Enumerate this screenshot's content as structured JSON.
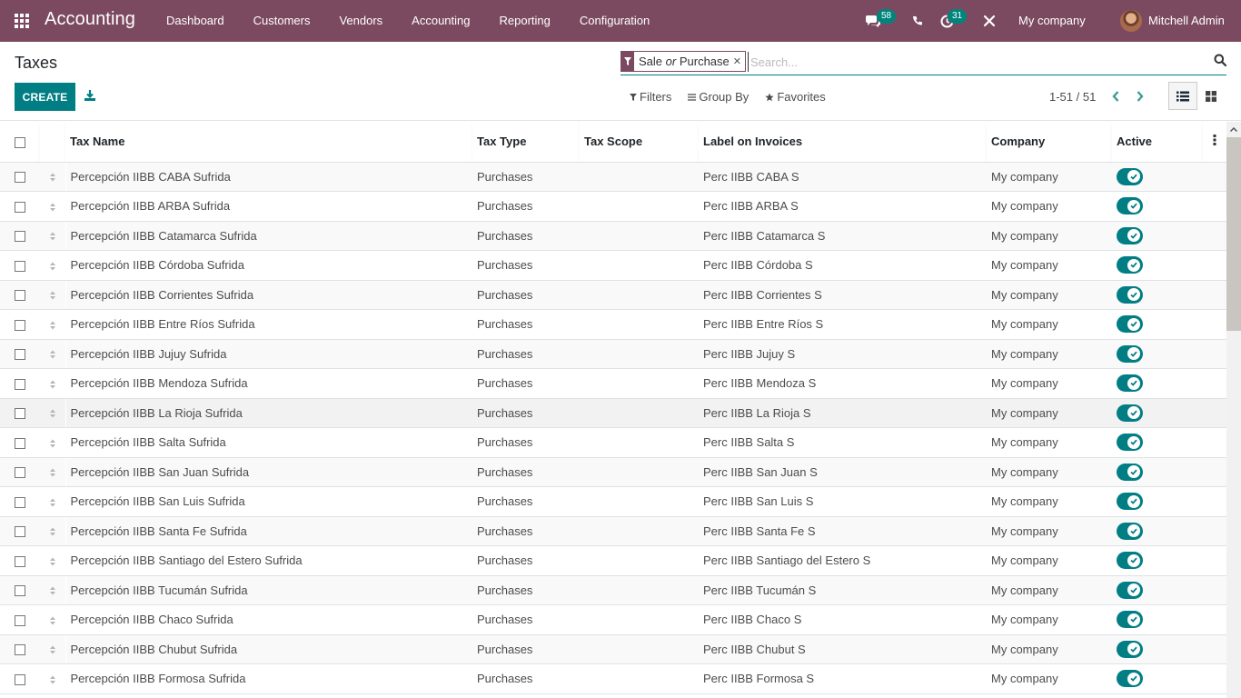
{
  "navbar": {
    "app_name": "Accounting",
    "menu": [
      "Dashboard",
      "Customers",
      "Vendors",
      "Accounting",
      "Reporting",
      "Configuration"
    ],
    "messages_count": "58",
    "activities_count": "31",
    "company": "My company",
    "user": "Mitchell Admin",
    "icons": [
      "apps-grid-icon",
      "chat-icon",
      "phone-icon",
      "activity-clock-icon",
      "debug-tools-icon"
    ]
  },
  "control_panel": {
    "title": "Taxes",
    "create_label": "CREATE",
    "facet": {
      "field": "Sale",
      "operator": "or",
      "value": "Purchase"
    },
    "search_placeholder": "Search...",
    "filters_label": "Filters",
    "groupby_label": "Group By",
    "favorites_label": "Favorites",
    "pager": "1-51 / 51"
  },
  "colors": {
    "brand": "#7c4a60",
    "primary": "#017e84",
    "badge": "#00857c"
  },
  "table": {
    "columns": [
      "Tax Name",
      "Tax Type",
      "Tax Scope",
      "Label on Invoices",
      "Company",
      "Active"
    ],
    "rows": [
      {
        "name": "Percepción IIBB CABA Sufrida",
        "type": "Purchases",
        "scope": "",
        "label": "Perc IIBB CABA S",
        "company": "My company",
        "active": true
      },
      {
        "name": "Percepción IIBB ARBA Sufrida",
        "type": "Purchases",
        "scope": "",
        "label": "Perc IIBB ARBA S",
        "company": "My company",
        "active": true
      },
      {
        "name": "Percepción IIBB Catamarca Sufrida",
        "type": "Purchases",
        "scope": "",
        "label": "Perc IIBB Catamarca S",
        "company": "My company",
        "active": true
      },
      {
        "name": "Percepción IIBB Córdoba Sufrida",
        "type": "Purchases",
        "scope": "",
        "label": "Perc IIBB Córdoba S",
        "company": "My company",
        "active": true
      },
      {
        "name": "Percepción IIBB Corrientes Sufrida",
        "type": "Purchases",
        "scope": "",
        "label": "Perc IIBB Corrientes S",
        "company": "My company",
        "active": true
      },
      {
        "name": "Percepción IIBB Entre Ríos Sufrida",
        "type": "Purchases",
        "scope": "",
        "label": "Perc IIBB Entre Ríos S",
        "company": "My company",
        "active": true
      },
      {
        "name": "Percepción IIBB Jujuy Sufrida",
        "type": "Purchases",
        "scope": "",
        "label": "Perc IIBB Jujuy S",
        "company": "My company",
        "active": true
      },
      {
        "name": "Percepción IIBB Mendoza Sufrida",
        "type": "Purchases",
        "scope": "",
        "label": "Perc IIBB Mendoza S",
        "company": "My company",
        "active": true
      },
      {
        "name": "Percepción IIBB La Rioja Sufrida",
        "type": "Purchases",
        "scope": "",
        "label": "Perc IIBB La Rioja S",
        "company": "My company",
        "active": true
      },
      {
        "name": "Percepción IIBB Salta Sufrida",
        "type": "Purchases",
        "scope": "",
        "label": "Perc IIBB Salta S",
        "company": "My company",
        "active": true
      },
      {
        "name": "Percepción IIBB San Juan Sufrida",
        "type": "Purchases",
        "scope": "",
        "label": "Perc IIBB San Juan S",
        "company": "My company",
        "active": true
      },
      {
        "name": "Percepción IIBB San Luis Sufrida",
        "type": "Purchases",
        "scope": "",
        "label": "Perc IIBB San Luis S",
        "company": "My company",
        "active": true
      },
      {
        "name": "Percepción IIBB Santa Fe Sufrida",
        "type": "Purchases",
        "scope": "",
        "label": "Perc IIBB Santa Fe S",
        "company": "My company",
        "active": true
      },
      {
        "name": "Percepción IIBB Santiago del Estero Sufrida",
        "type": "Purchases",
        "scope": "",
        "label": "Perc IIBB Santiago del Estero S",
        "company": "My company",
        "active": true
      },
      {
        "name": "Percepción IIBB Tucumán Sufrida",
        "type": "Purchases",
        "scope": "",
        "label": "Perc IIBB Tucumán S",
        "company": "My company",
        "active": true
      },
      {
        "name": "Percepción IIBB Chaco Sufrida",
        "type": "Purchases",
        "scope": "",
        "label": "Perc IIBB Chaco S",
        "company": "My company",
        "active": true
      },
      {
        "name": "Percepción IIBB Chubut Sufrida",
        "type": "Purchases",
        "scope": "",
        "label": "Perc IIBB Chubut S",
        "company": "My company",
        "active": true
      },
      {
        "name": "Percepción IIBB Formosa Sufrida",
        "type": "Purchases",
        "scope": "",
        "label": "Perc IIBB Formosa S",
        "company": "My company",
        "active": true
      }
    ]
  }
}
